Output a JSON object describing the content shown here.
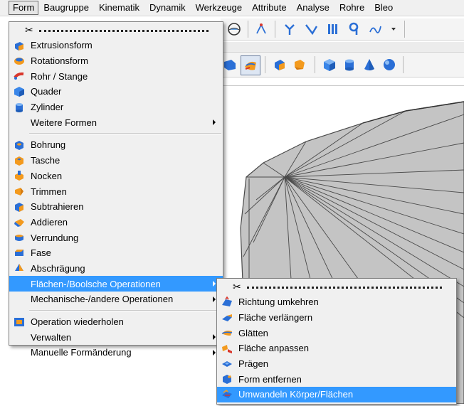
{
  "menubar": {
    "items": [
      "Form",
      "Baugruppe",
      "Kinematik",
      "Dynamik",
      "Werkzeuge",
      "Attribute",
      "Analyse",
      "Rohre",
      "Bleo"
    ]
  },
  "form_menu": {
    "tear_off": "tear-off",
    "items": [
      {
        "label": "Extrusionsform",
        "icon": "extrusion-icon"
      },
      {
        "label": "Rotationsform",
        "icon": "rotation-icon"
      },
      {
        "label": "Rohr / Stange",
        "icon": "pipe-icon"
      },
      {
        "label": "Quader",
        "icon": "box-icon"
      },
      {
        "label": "Zylinder",
        "icon": "cylinder-icon"
      },
      {
        "label": "Weitere Formen",
        "submenu": true
      },
      {
        "label": "Bohrung",
        "icon": "hole-icon"
      },
      {
        "label": "Tasche",
        "icon": "pocket-icon"
      },
      {
        "label": "Nocken",
        "icon": "cam-icon"
      },
      {
        "label": "Trimmen",
        "icon": "trim-icon"
      },
      {
        "label": "Subtrahieren",
        "icon": "subtract-icon"
      },
      {
        "label": "Addieren",
        "icon": "add-icon"
      },
      {
        "label": "Verrundung",
        "icon": "fillet-icon"
      },
      {
        "label": "Fase",
        "icon": "chamfer-icon"
      },
      {
        "label": "Abschrägung",
        "icon": "bevel-icon"
      },
      {
        "label": "Flächen-/Boolsche Operationen",
        "submenu": true,
        "highlighted": true
      },
      {
        "label": "Mechanische-/andere Operationen",
        "submenu": true
      },
      {
        "label": "Operation wiederholen",
        "icon": "repeat-icon"
      },
      {
        "label": "Verwalten",
        "submenu": true
      },
      {
        "label": "Manuelle Formänderung",
        "submenu": true
      }
    ]
  },
  "sub_menu": {
    "items": [
      {
        "label": "Richtung umkehren",
        "icon": "reverse-direction-icon"
      },
      {
        "label": "Fläche verlängern",
        "icon": "extend-surface-icon"
      },
      {
        "label": "Glätten",
        "icon": "smooth-icon"
      },
      {
        "label": "Fläche anpassen",
        "icon": "adjust-surface-icon"
      },
      {
        "label": "Prägen",
        "icon": "emboss-icon"
      },
      {
        "label": "Form entfernen",
        "icon": "remove-shape-icon"
      },
      {
        "label": "Umwandeln Körper/Flächen",
        "icon": "convert-body-icon",
        "highlighted": true
      }
    ]
  },
  "colors": {
    "highlight": "#3399ff",
    "menu_bg": "#f0f0f0",
    "icon_blue": "#2b6fd6",
    "icon_orange": "#f39a1e",
    "icon_red": "#d9362b",
    "mesh_fill": "#c4c4c4",
    "mesh_line": "#4a4a4a"
  }
}
